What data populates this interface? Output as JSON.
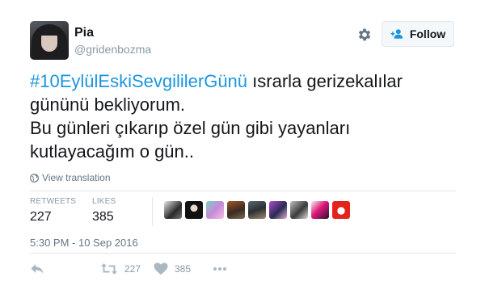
{
  "user": {
    "name": "Pia",
    "handle": "@gridenbozma"
  },
  "header": {
    "follow_label": "Follow"
  },
  "tweet": {
    "hashtag": "#10EylülEskiSevgililerGünü",
    "line1_rest": " ısrarla gerizekalılar",
    "line2": "gününü bekliyorum.",
    "line3": "Bu günleri çıkarıp özel gün gibi yayanları",
    "line4": "kutlayacağım o gün..",
    "translation_link": "View translation",
    "timestamp": "5:30 PM - 10 Sep 2016"
  },
  "stats": {
    "retweets_label": "RETWEETS",
    "retweets_value": "227",
    "likes_label": "LIKES",
    "likes_value": "385"
  },
  "actions": {
    "retweet_count": "227",
    "like_count": "385"
  },
  "icons": {
    "gear": "gear-icon",
    "follow": "add-user-icon",
    "globe": "globe-icon",
    "reply": "reply-icon",
    "retweet": "retweet-icon",
    "like": "heart-icon",
    "more": "more-icon"
  },
  "colors": {
    "link": "#1b95e0",
    "muted": "#8899a6",
    "text": "#14171a",
    "border": "#e1e8ed"
  }
}
